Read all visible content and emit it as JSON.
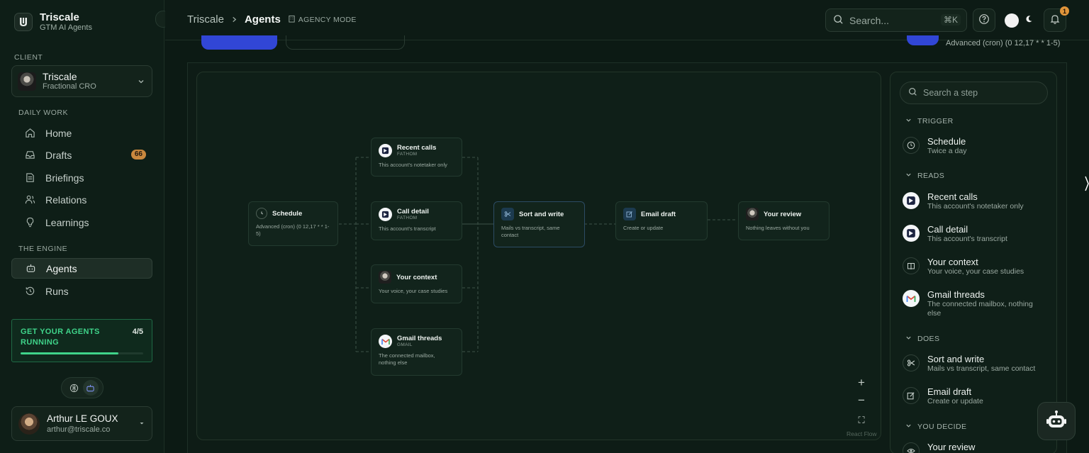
{
  "brand": {
    "name": "Triscale",
    "subtitle": "GTM AI Agents"
  },
  "sidebar": {
    "client_label": "CLIENT",
    "client": {
      "name": "Triscale",
      "role": "Fractional CRO"
    },
    "daily_label": "DAILY WORK",
    "daily_items": [
      {
        "label": "Home",
        "icon": "home-icon"
      },
      {
        "label": "Drafts",
        "icon": "inbox-icon",
        "badge": "66"
      },
      {
        "label": "Briefings",
        "icon": "document-icon"
      },
      {
        "label": "Relations",
        "icon": "users-icon"
      },
      {
        "label": "Learnings",
        "icon": "lightbulb-icon"
      }
    ],
    "engine_label": "THE ENGINE",
    "engine_items": [
      {
        "label": "Agents",
        "icon": "robot-icon",
        "active": true
      },
      {
        "label": "Runs",
        "icon": "history-icon"
      }
    ],
    "progress": {
      "title": "GET YOUR AGENTS RUNNING",
      "count": "4/5",
      "fraction": 0.8
    },
    "user": {
      "name": "Arthur LE GOUX",
      "email": "arthur@triscale.co"
    }
  },
  "topbar": {
    "crumb_root": "Triscale",
    "crumb_current": "Agents",
    "mode": "AGENCY MODE",
    "search_placeholder": "Search...",
    "search_kbd": "⌘K",
    "notif_count": "1"
  },
  "schedule_summary": "Advanced (cron) (0 12,17 * * 1-5)",
  "flow": {
    "nodes": [
      {
        "id": "schedule",
        "title": "Schedule",
        "src": "",
        "desc": "Advanced (cron) (0 12,17 * * 1-5)"
      },
      {
        "id": "recent",
        "title": "Recent calls",
        "src": "FATHOM",
        "desc": "This account's notetaker only"
      },
      {
        "id": "calldetail",
        "title": "Call detail",
        "src": "FATHOM",
        "desc": "This account's transcript"
      },
      {
        "id": "context",
        "title": "Your context",
        "src": "",
        "desc": "Your voice, your case studies"
      },
      {
        "id": "gmail",
        "title": "Gmail threads",
        "src": "GMAIL",
        "desc": "The connected mailbox, nothing else"
      },
      {
        "id": "sort",
        "title": "Sort and write",
        "src": "",
        "desc": "Mails vs transcript, same contact"
      },
      {
        "id": "email",
        "title": "Email draft",
        "src": "",
        "desc": "Create or update"
      },
      {
        "id": "review",
        "title": "Your review",
        "src": "",
        "desc": "Nothing leaves without you"
      }
    ],
    "zoom_in": "+",
    "zoom_out": "−",
    "fit": "⛶",
    "attribution": "React Flow"
  },
  "palette": {
    "search_placeholder": "Search a step",
    "groups": [
      {
        "label": "TRIGGER",
        "items": [
          {
            "title": "Schedule",
            "desc": "Twice a day",
            "icon": "clock-icon"
          }
        ]
      },
      {
        "label": "READS",
        "items": [
          {
            "title": "Recent calls",
            "desc": "This account's notetaker only",
            "icon": "fathom-icon"
          },
          {
            "title": "Call detail",
            "desc": "This account's transcript",
            "icon": "fathom-icon"
          },
          {
            "title": "Your context",
            "desc": "Your voice, your case studies",
            "icon": "book-icon"
          },
          {
            "title": "Gmail threads",
            "desc": "The connected mailbox, nothing else",
            "icon": "gmail-icon"
          }
        ]
      },
      {
        "label": "DOES",
        "items": [
          {
            "title": "Sort and write",
            "desc": "Mails vs transcript, same contact",
            "icon": "scissors-icon"
          },
          {
            "title": "Email draft",
            "desc": "Create or update",
            "icon": "edit-icon"
          }
        ]
      },
      {
        "label": "YOU DECIDE",
        "items": [
          {
            "title": "Your review",
            "desc": "",
            "icon": "eye-icon"
          }
        ]
      }
    ]
  },
  "colors": {
    "accent": "#3fd48a",
    "badge": "#c9883e",
    "primary": "#3146d6",
    "background": "#0c1a14"
  }
}
